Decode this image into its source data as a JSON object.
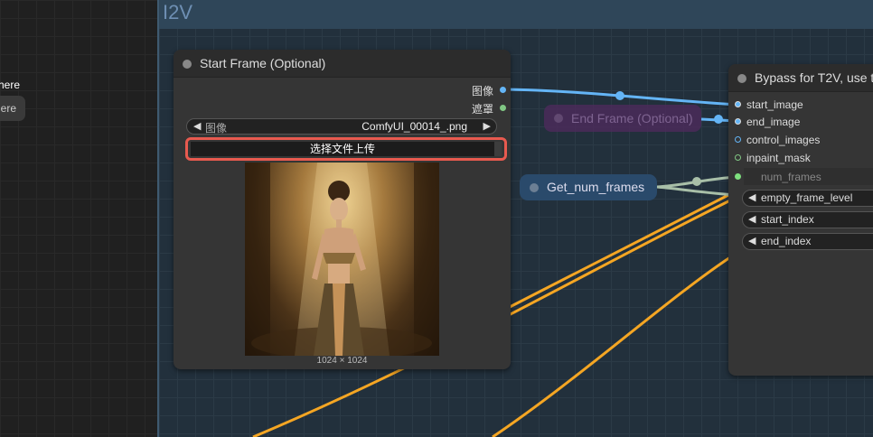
{
  "left_panel": {
    "partial_text": "here",
    "partial_button": "ere"
  },
  "group": {
    "title": "I2V"
  },
  "start_frame_node": {
    "title": "Start Frame (Optional)",
    "outputs": [
      {
        "label": "图像"
      },
      {
        "label": "遮罩"
      }
    ],
    "image_widget": {
      "label": "图像",
      "value": "ComfyUI_00014_.png"
    },
    "upload_button": "选择文件上传",
    "image_size": "1024 × 1024"
  },
  "end_frame_node": {
    "title": "End Frame (Optional)"
  },
  "get_num_frames_node": {
    "title": "Get_num_frames"
  },
  "bypass_node": {
    "title": "Bypass for T2V, use t",
    "inputs": [
      {
        "label": "start_image"
      },
      {
        "label": "end_image"
      },
      {
        "label": "control_images"
      },
      {
        "label": "inpaint_mask"
      },
      {
        "label": "num_frames"
      }
    ],
    "widgets": [
      {
        "label": "empty_frame_level"
      },
      {
        "label": "start_index"
      },
      {
        "label": "end_index"
      }
    ]
  },
  "colors": {
    "image_link": "#64b5f6",
    "mask_link": "#81c784",
    "int_link": "#a8bfa8",
    "float_link": "#f5a623",
    "highlight": "#e85a4f"
  }
}
